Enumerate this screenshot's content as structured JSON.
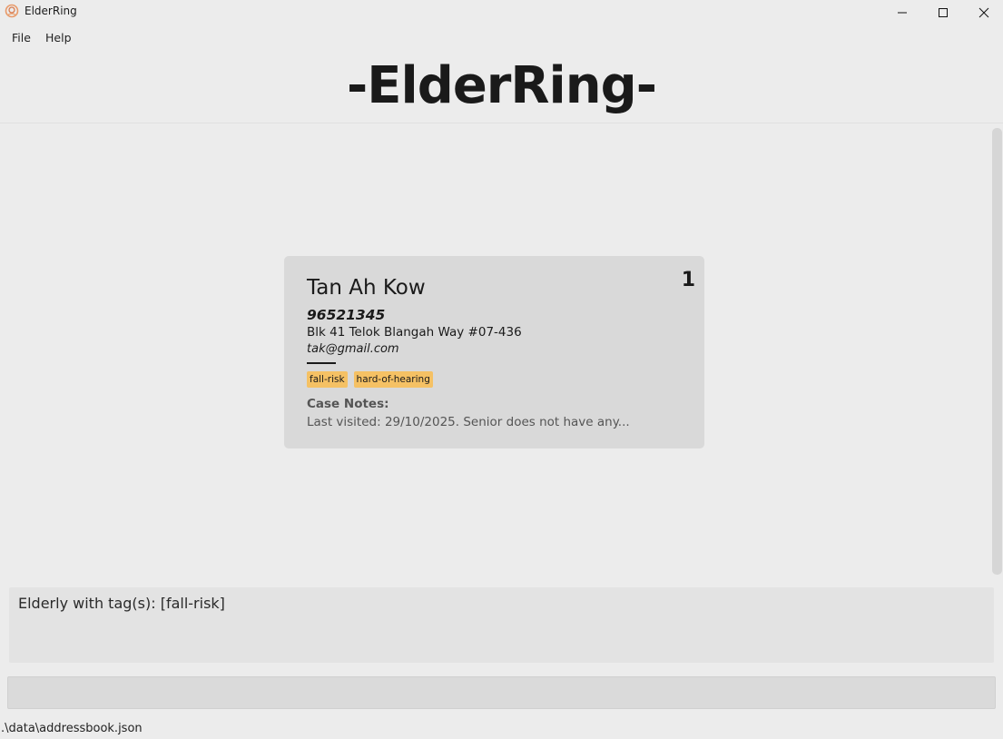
{
  "window": {
    "title": "ElderRing"
  },
  "menu": {
    "items": [
      "File",
      "Help"
    ]
  },
  "header": {
    "title": "-ElderRing-"
  },
  "person_card": {
    "index": "1",
    "name": "Tan Ah Kow",
    "phone": "96521345",
    "address": "Blk 41 Telok Blangah Way #07-436",
    "email": "tak@gmail.com",
    "tags": [
      "fall-risk",
      "hard-of-hearing"
    ],
    "notes_label": "Case Notes:",
    "notes_text": "Last visited: 29/10/2025. Senior does not have any..."
  },
  "result": {
    "text": "Elderly with tag(s): [fall-risk]"
  },
  "command": {
    "value": ""
  },
  "status": {
    "path": ".\\data\\addressbook.json"
  },
  "colors": {
    "tag_background": "#f5c164",
    "card_background": "#d9d9d9",
    "window_background": "#ececec"
  }
}
